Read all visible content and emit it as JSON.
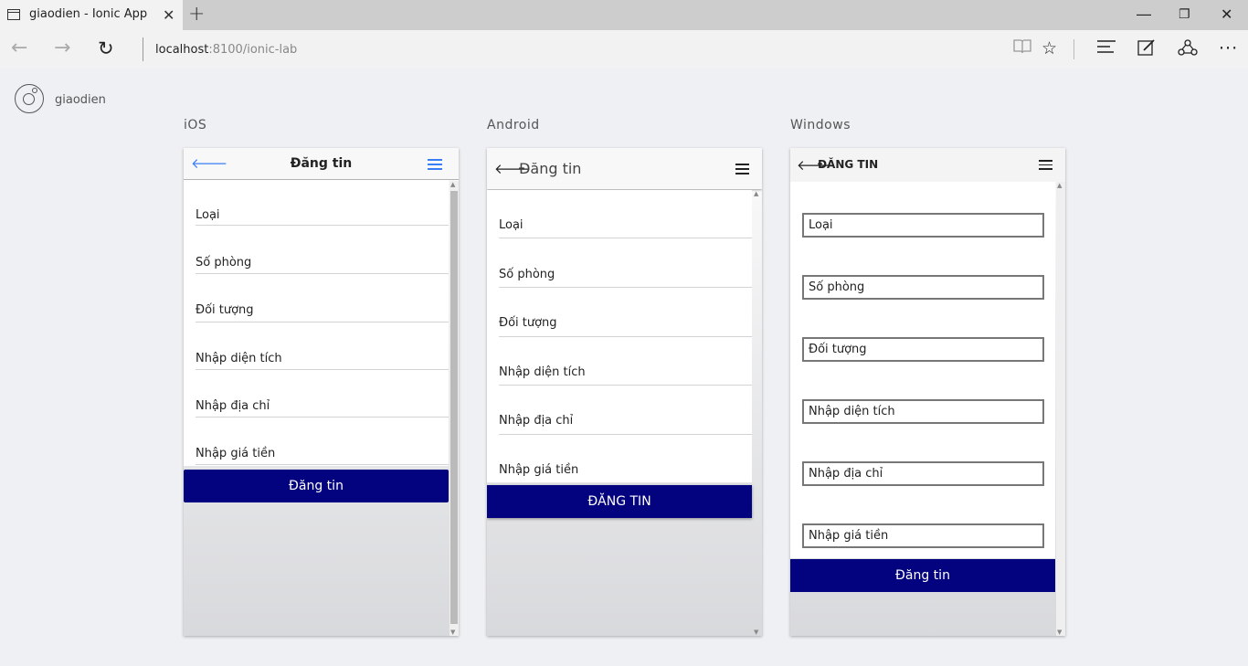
{
  "browser": {
    "tab_title": "giaodien - Ionic App",
    "tab_close": "✕",
    "new_tab": "+",
    "url_host": "localhost",
    "url_rest": ":8100/ionic-lab",
    "icons": [
      "back-icon",
      "forward-icon",
      "refresh-icon",
      "reading-view-icon",
      "favorite-icon",
      "hub-icon",
      "web-note-icon",
      "share-icon",
      "more-icon"
    ]
  },
  "lab": {
    "brand_name": "giaodien",
    "platforms": {
      "ios": {
        "label": "iOS",
        "title": "Đăng tin",
        "fields": [
          "Loại",
          "Số phòng",
          "Đối tượng",
          "Nhập diện tích",
          "Nhập địa chỉ",
          "Nhập giá tiền"
        ],
        "button": "Đăng tin",
        "accent": "#387ef5"
      },
      "android": {
        "label": "Android",
        "title": "Đăng tin",
        "fields": [
          "Loại",
          "Số phòng",
          "Đối tượng",
          "Nhập diện tích",
          "Nhập địa chỉ",
          "Nhập giá tiền"
        ],
        "button": "ĐĂNG TIN"
      },
      "windows": {
        "label": "Windows",
        "title": "ĐĂNG TIN",
        "fields": [
          "Loại",
          "Số phòng",
          "Đối tượng",
          "Nhập diện tích",
          "Nhập địa chỉ",
          "Nhập giá tiền"
        ],
        "button": "Đăng tin"
      }
    },
    "button_color": "#03027f"
  }
}
